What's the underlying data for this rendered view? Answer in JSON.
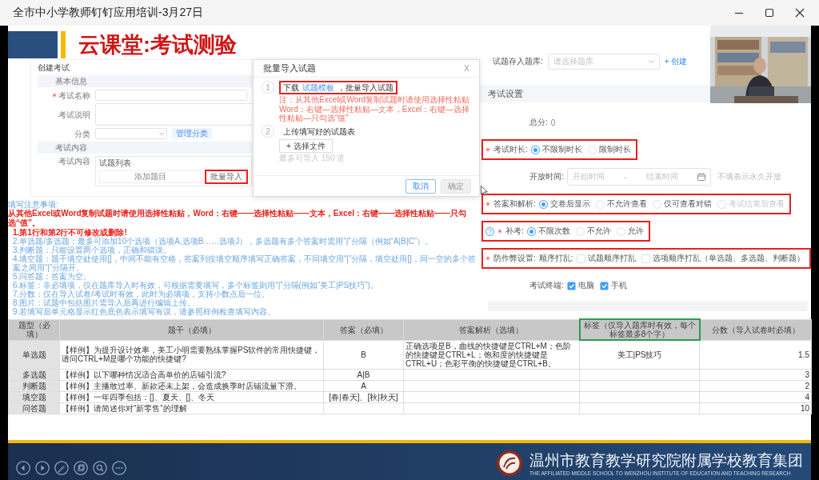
{
  "window": {
    "title": "全市中小学教师钉钉应用培训-3月27日"
  },
  "slide": {
    "title": "云课堂:考试测验"
  },
  "exam_form": {
    "heading": "创建考试",
    "basic_section": "基本信息",
    "fields": [
      {
        "kind": "input",
        "label": "考试名称",
        "required": true
      },
      {
        "kind": "textarea",
        "label": "考试说明",
        "required": false
      },
      {
        "kind": "select",
        "label": "分类",
        "required": false,
        "action": "管理分类"
      }
    ],
    "content_section": "考试内容",
    "content": {
      "label": "考试内容",
      "list_title": "试题列表",
      "add_button": "添加题目",
      "import_button": {
        "label": "批量导入",
        "highlighted": true
      }
    }
  },
  "import_dialog": {
    "title": "批量导入试题",
    "close": "X",
    "steps": [
      {
        "number": "1",
        "text_before": "下载",
        "link": "试题模板",
        "text_after": "，批量导入试题",
        "highlighted": true,
        "notes": [
          "注：从其他Excel或Word复制试题时请使用选择性粘贴",
          "Word：右键—选择性粘贴—文本，Excel：右键—选择性粘贴—只勾选“值”"
        ]
      },
      {
        "number": "2",
        "text": "上传填写好的试题表",
        "button": "+ 选择文件",
        "hint": "最多可导入 150 道",
        "highlighted": false
      }
    ],
    "buttons": [
      {
        "label": "取消",
        "disabled": false
      },
      {
        "label": "确定",
        "disabled": true
      }
    ]
  },
  "sheet": {
    "notes_title": "填写注意事项:",
    "warning": "从其他Excel或Word复制试题时请使用选择性粘贴，Word：右键——选择性粘贴——文本，Excel：右键——选择性粘贴——只勾选“值”。",
    "notes": [
      {
        "text": "1.第1行和第2行不可修改或删除!",
        "emphasis": true
      },
      {
        "text": "2.单选题/多选题：最多可添加10个选项（选项A,选项B……选项J），多选题有多个答案时需用“|”分隔（例如“A|B|C”）。",
        "emphasis": false
      },
      {
        "text": "3.判断题：只能设置两个选项，正确和错误。",
        "emphasis": false
      },
      {
        "text": "4.填空题：题干填空处使用[]，中间不能有空格，答案列按填空顺序填写正确答案，不同填空用“|”分隔，填空处用[]，同一空的多个答案之间用“|”分隔开。",
        "emphasis": false
      },
      {
        "text": "5.问答题：答案为空。",
        "emphasis": false
      },
      {
        "text": "6.标签：非必填项，仅在题库导入时有效，可根据需要填写，多个标签则用“|”分隔(例如“美工|PS技巧”)。",
        "emphasis": false
      },
      {
        "text": "7.分数：仅在导入试卷/考试时有效，此时为必填项，支持小数点后一位。",
        "emphasis": false
      },
      {
        "text": "8.图片：试题中包括图片需导入后再进行编辑上传。",
        "emphasis": false
      },
      {
        "text": "9.若填写后单元格显示红色底色表示填写有误，请参照样例检查填写内容。",
        "emphasis": false
      }
    ],
    "columns": [
      {
        "label": "题型（必填）",
        "selected": false
      },
      {
        "label": "题干（必填）",
        "selected": false
      },
      {
        "label": "答案（必填）",
        "selected": false
      },
      {
        "label": "答案解析（选填）",
        "selected": false
      },
      {
        "label": "标签（仅导入题库时有效，每个标签最多8个字）",
        "selected": true
      },
      {
        "label": "分数（导入试卷时必填）",
        "selected": false
      }
    ],
    "rows": [
      [
        "单选题",
        "【样例】为提升设计效率，美工小明需要熟练掌握PS软件的常用快捷键，请问CTRL+M是哪个功能的快捷键?",
        "B",
        "正确选项是B，曲线的快捷键是CTRL+M；色阶的快捷键是CTRL+L；饱和度的快捷键是CTRL+U；色彩平衡的快捷键是CTRL+B。",
        "美工|PS技巧",
        "1.5"
      ],
      [
        "多选题",
        "【样例】以下哪种情况适合高单价的店铺引流?",
        "A|B",
        "",
        "",
        "3"
      ],
      [
        "判断题",
        "【样例】主播敢过率、新款还未上架，会造成换季时店铺流量下滑。",
        "A",
        "",
        "",
        "2"
      ],
      [
        "填空题",
        "【样例】一年四季包括：[]、夏天、[]、冬天",
        "[春|春天]、[秋|秋天]",
        "",
        "",
        "4"
      ],
      [
        "问答题",
        "【样例】请简述你对“新零售”的理解",
        "",
        "",
        "",
        "10"
      ]
    ]
  },
  "settings": {
    "bank_label": "试题存入题库:",
    "bank_placeholder": "请选择题库",
    "create_link": "+ 创建",
    "heading": "考试设置",
    "rows": [
      {
        "kind": "value",
        "label": "总分:",
        "value": "0",
        "required": false,
        "highlighted": false
      },
      {
        "kind": "radio",
        "label": "考试时长:",
        "required": true,
        "highlighted": true,
        "options": [
          {
            "label": "不限制时长",
            "selected": true,
            "disabled": false
          },
          {
            "label": "限制时长",
            "selected": false,
            "disabled": false
          }
        ]
      },
      {
        "kind": "range",
        "label": "开放时间:",
        "required": false,
        "highlighted": false,
        "start": "开始时间",
        "separator": "-",
        "end": "结束时间",
        "hint": "不填表示永久开放"
      },
      {
        "kind": "radio",
        "label": "答案和解析:",
        "required": true,
        "highlighted": true,
        "options": [
          {
            "label": "交卷后显示",
            "selected": true,
            "disabled": false
          },
          {
            "label": "不允许查看",
            "selected": false,
            "disabled": false
          },
          {
            "label": "仅可查看对错",
            "selected": false,
            "disabled": false
          },
          {
            "label": "考试结束后查看",
            "selected": false,
            "disabled": true
          }
        ]
      },
      {
        "kind": "radio",
        "label": "补考:",
        "help": true,
        "required": true,
        "highlighted": true,
        "options": [
          {
            "label": "不限次数",
            "selected": true,
            "disabled": false
          },
          {
            "label": "不允许",
            "selected": false,
            "disabled": false
          },
          {
            "label": "允许",
            "selected": false,
            "disabled": false
          }
        ]
      },
      {
        "kind": "checkbox",
        "label": "防作弊设置:",
        "sublabel": "顺序打乱:",
        "required": true,
        "highlighted": true,
        "options": [
          {
            "label": "试题顺序打乱",
            "checked": false
          },
          {
            "label": "选项顺序打乱（单选题、多选题、判断题）",
            "checked": false
          }
        ]
      },
      {
        "kind": "checkbox",
        "label": "考试终端:",
        "required": false,
        "highlighted": false,
        "options": [
          {
            "label": "电脑",
            "checked": true
          },
          {
            "label": "手机",
            "checked": true
          }
        ]
      }
    ]
  },
  "footer": {
    "org_name": "温州市教育教学研究院附属学校教育集团",
    "org_subtitle": "THE AFFILIATED MIDDLE SCHOOL TO WENZHOU INSTITUTE OF EDUCATION AND TEACHING RESEARCH"
  }
}
